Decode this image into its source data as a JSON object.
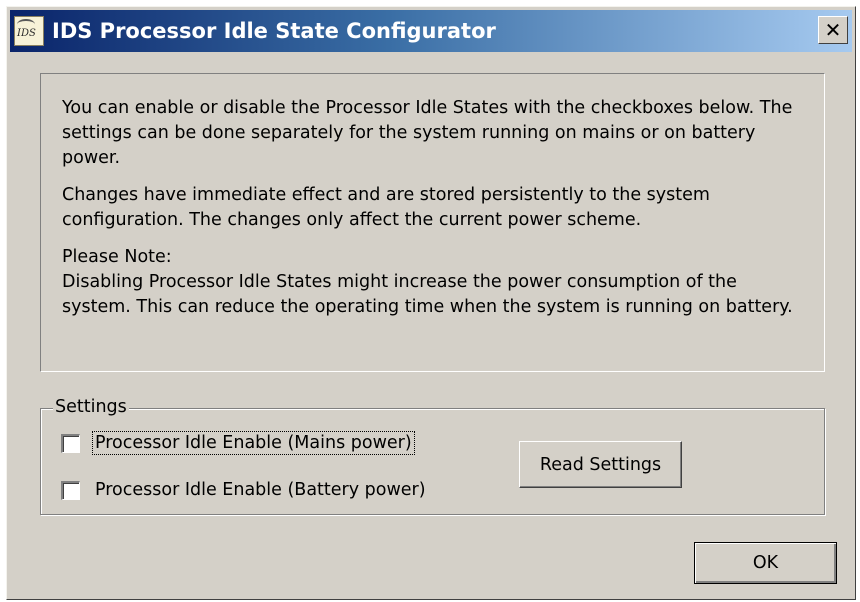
{
  "window": {
    "title": "IDS Processor Idle State Configurator",
    "close_glyph": "✕"
  },
  "info": {
    "paragraph_1": "You can enable or disable the Processor Idle States with the checkboxes below. The settings can be done separately for the system running on mains or on battery power.",
    "paragraph_2": "Changes have immediate effect and are stored persistently to the system configuration. The changes only affect the current power scheme.",
    "note_heading": "Please Note:",
    "note_body": "Disabling Processor Idle States might increase the power consumption of the system. This can reduce the operating time when the system is running on battery."
  },
  "settings": {
    "legend": "Settings",
    "checkboxes": [
      {
        "label": "Processor Idle Enable (Mains power)",
        "checked": false,
        "focused": true
      },
      {
        "label": "Processor Idle Enable (Battery power)",
        "checked": false,
        "focused": false
      }
    ],
    "read_button_label": "Read Settings"
  },
  "footer": {
    "ok_label": "OK"
  },
  "icons": {
    "app": "ids-app-icon",
    "close": "close-icon"
  },
  "colors": {
    "titlebar_start": "#0a246a",
    "titlebar_end": "#a6caf0",
    "dialog_background": "#d4d0c8"
  }
}
